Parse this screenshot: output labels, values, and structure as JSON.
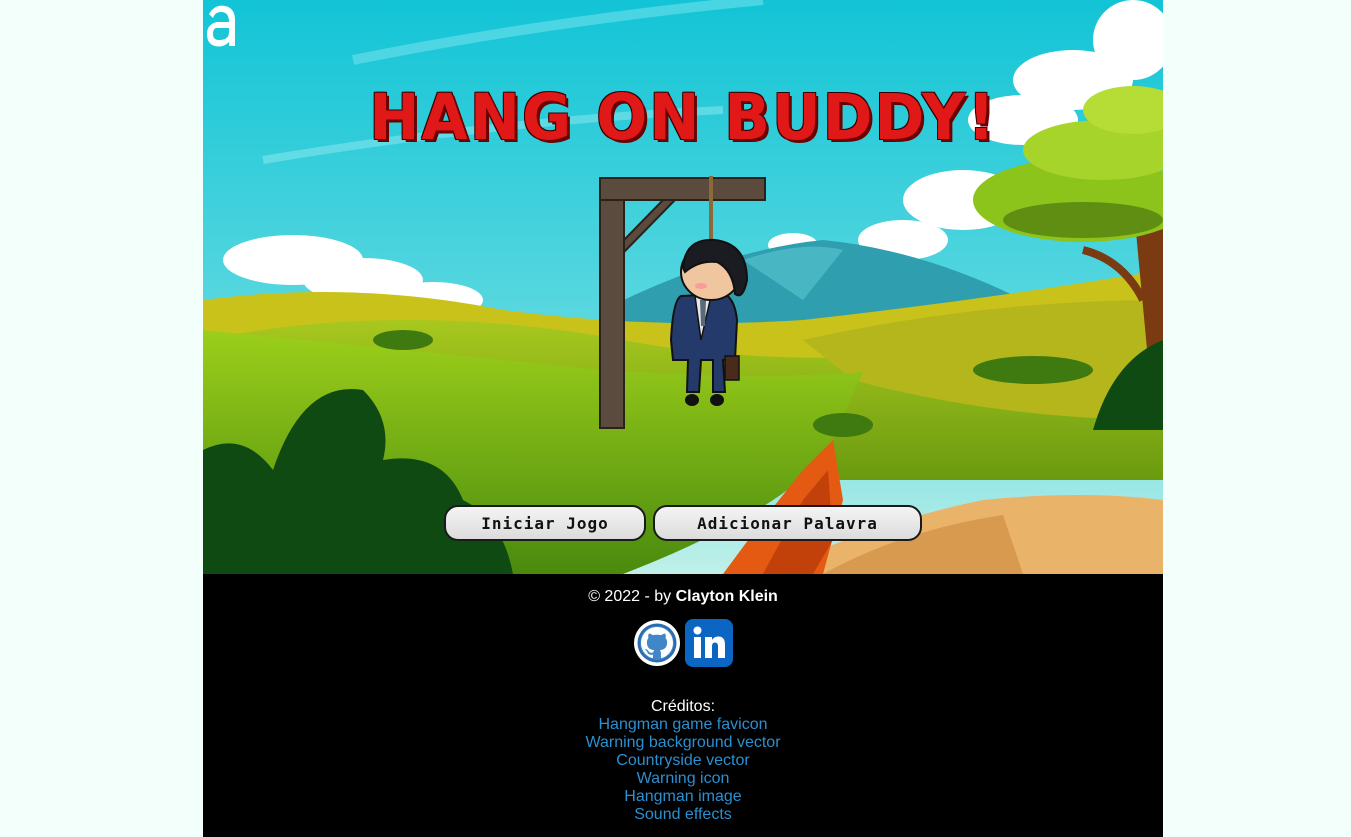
{
  "game": {
    "title": "HANG ON BUDDY!",
    "start_button": "Iniciar Jogo",
    "add_word_button": "Adicionar Palavra"
  },
  "footer": {
    "copyright_prefix": "© 2022 - by ",
    "author": "Clayton Klein",
    "credits_title": "Créditos:",
    "credits": [
      "Hangman game favicon",
      "Warning background vector",
      "Countryside vector",
      "Warning icon",
      "Hangman image",
      "Sound effects"
    ]
  },
  "icons": {
    "logo": "alura-logo",
    "github": "github-icon",
    "linkedin": "linkedin-icon"
  },
  "colors": {
    "title": "#e11818",
    "link": "#2c8fcf",
    "footer_bg": "#000000",
    "page_bg": "#f2fffa"
  }
}
